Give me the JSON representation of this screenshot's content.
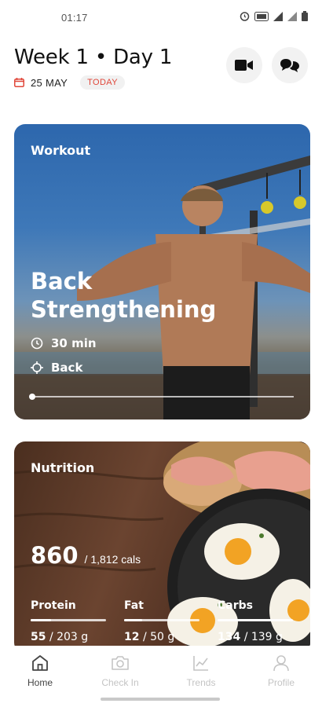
{
  "status_bar": {
    "time": "01:17",
    "icons": [
      "alarm-icon",
      "volte-icon",
      "signal-icon",
      "signal-icon",
      "battery-icon"
    ]
  },
  "header": {
    "title": "Week 1 • Day 1",
    "date": "25 MAY",
    "today_badge": "TODAY",
    "actions": [
      "video-icon",
      "chat-icon"
    ]
  },
  "workout": {
    "label": "Workout",
    "title": "Back Strengthening",
    "duration": "30 min",
    "muscle": "Back",
    "progress_fraction": 0.0
  },
  "nutrition": {
    "label": "Nutrition",
    "calories_value": "860",
    "calories_target": "/ 1,812 cals",
    "macros": [
      {
        "label": "Protein",
        "value": "55",
        "target": "/ 203 g",
        "progress": 0.27
      },
      {
        "label": "Fat",
        "value": "12",
        "target": "/ 50 g",
        "progress": 0.24
      },
      {
        "label": "Carbs",
        "value": "134",
        "target": "/ 139 g",
        "progress": 0.96
      }
    ]
  },
  "nav": {
    "items": [
      {
        "label": "Home",
        "icon": "home-icon",
        "active": true
      },
      {
        "label": "Check In",
        "icon": "camera-icon",
        "active": false
      },
      {
        "label": "Trends",
        "icon": "trends-icon",
        "active": false
      },
      {
        "label": "Profile",
        "icon": "profile-icon",
        "active": false
      }
    ]
  },
  "colors": {
    "accent_red": "#e0473a",
    "nav_inactive": "#c4c4c4",
    "nav_active": "#444444"
  }
}
